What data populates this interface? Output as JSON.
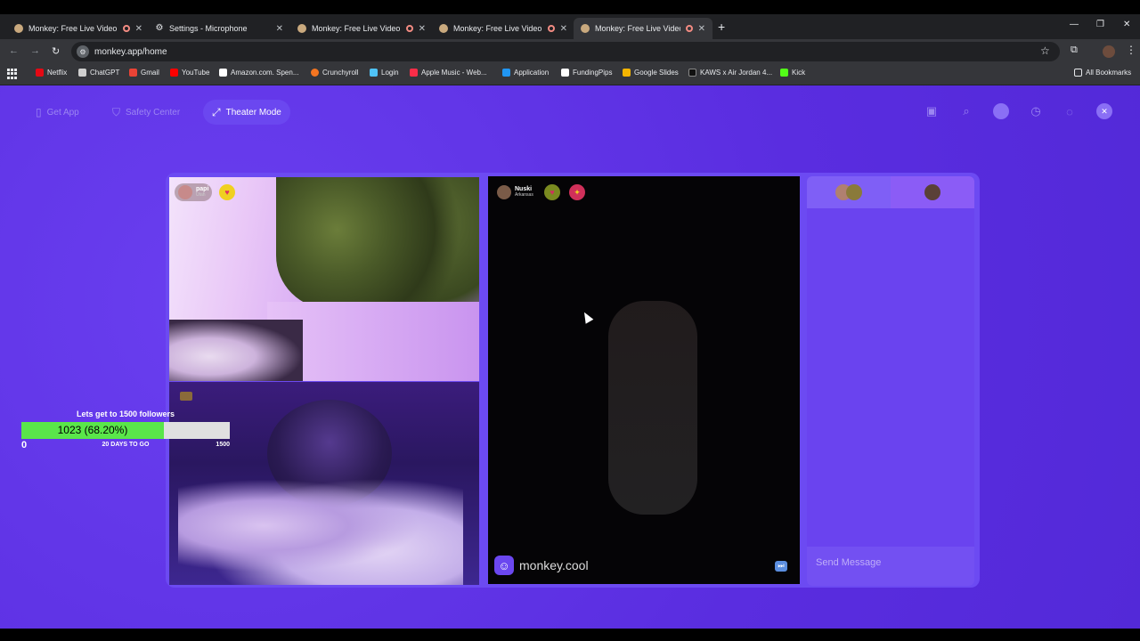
{
  "tabs": [
    {
      "title": "Monkey: Free Live Video Ch",
      "favicon": "monkey-favicon",
      "recording": true
    },
    {
      "title": "Settings - Microphone",
      "favicon": "gear-icon",
      "recording": false
    },
    {
      "title": "Monkey: Free Live Video Ch",
      "favicon": "monkey-favicon",
      "recording": true
    },
    {
      "title": "Monkey: Free Live Video Ch",
      "favicon": "monkey-favicon",
      "recording": true
    },
    {
      "title": "Monkey: Free Live Video Ch",
      "favicon": "monkey-favicon",
      "recording": true,
      "active": true
    }
  ],
  "address": {
    "url": "monkey.app/home"
  },
  "bookmarks": [
    {
      "label": "Netflix",
      "color": "#e50914"
    },
    {
      "label": "ChatGPT",
      "color": "#cfcfcf"
    },
    {
      "label": "Gmail",
      "color": "#ea4335"
    },
    {
      "label": "YouTube",
      "color": "#ff0000"
    },
    {
      "label": "Amazon.com. Spen...",
      "color": "#ffffff"
    },
    {
      "label": "Crunchyroll",
      "color": "#f47521"
    },
    {
      "label": "Login",
      "color": "#4fc3f7"
    },
    {
      "label": "Apple Music - Web...",
      "color": "#fa2d48"
    },
    {
      "label": "Application",
      "color": "#2196f3"
    },
    {
      "label": "FundingPips",
      "color": "#ffffff"
    },
    {
      "label": "Google Slides",
      "color": "#f4b400"
    },
    {
      "label": "KAWS x Air Jordan 4...",
      "color": "#111111"
    },
    {
      "label": "Kick",
      "color": "#53fc18"
    }
  ],
  "all_bookmarks": "All Bookmarks",
  "nav": {
    "get_app": "Get App",
    "safety_center": "Safety Center",
    "theater_mode": "Theater Mode"
  },
  "video1_user": {
    "name": "papi",
    "location": "Utah"
  },
  "video3_user": {
    "name": "Nuski",
    "location": "Arkansas"
  },
  "watermark": "monkey.cool",
  "chat": {
    "placeholder": "Send Message"
  },
  "goal": {
    "title": "Lets get to 1500 followers",
    "label": "1023 (68.20%)",
    "progress": 0.682,
    "min": "0",
    "max": "1500",
    "days": "20 DAYS TO GO"
  },
  "colors": {
    "page_bg": "#5a2de0",
    "stage_bg": "#6c4af2",
    "goal_fill": "#5ae64a"
  }
}
